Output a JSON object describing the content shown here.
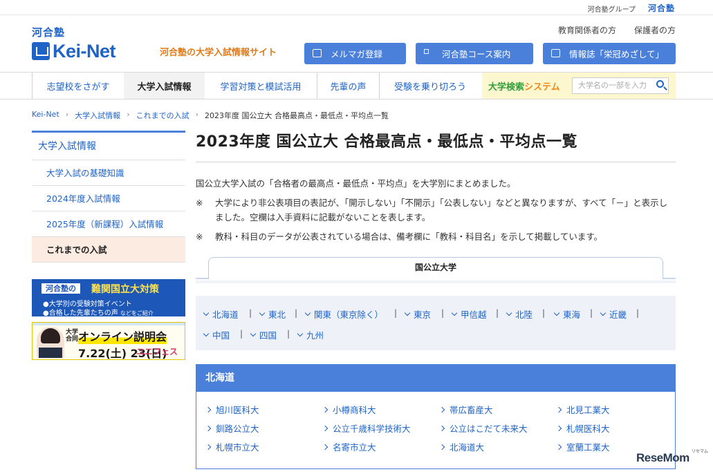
{
  "topbar": {
    "group_text": "河合塾グループ",
    "group_logo": "河合塾"
  },
  "header": {
    "logo_kanji": "河合塾",
    "logo_word": "Kei-Net",
    "tagline": "河合塾の大学入試情報サイト",
    "links": [
      "教育関係者の方",
      "保護者の方"
    ],
    "buttons": [
      {
        "label": "メルマガ登録",
        "icon": "mail-icon"
      },
      {
        "label": "河合塾コース案内",
        "icon": "grid-icon"
      },
      {
        "label": "情報誌「栄冠めざして」",
        "icon": "book-icon"
      }
    ]
  },
  "nav": {
    "items": [
      "志望校をさがす",
      "大学入試情報",
      "学習対策と模試活用",
      "先輩の声",
      "受験を乗り切ろう"
    ],
    "active_index": 1,
    "search_label_a": "大学検索",
    "search_label_b": "システム",
    "search_placeholder": "大学名の一部を入力"
  },
  "breadcrumb": {
    "items": [
      "Kei-Net",
      "大学入試情報",
      "これまでの入試",
      "2023年度 国公立大 合格最高点・最低点・平均点一覧"
    ],
    "separator": "›"
  },
  "sidebar": {
    "title": "大学入試情報",
    "items": [
      "大学入試の基礎知識",
      "2024年度入試情報",
      "2025年度（新課程）入試情報",
      "これまでの入試"
    ],
    "active_index": 3
  },
  "banner1": {
    "tag": "河合塾の",
    "headline": "難関国立大対策",
    "line1": "●大学別の受験対策イベント",
    "line2": "●合格した先輩たちの声",
    "line2_small": "などをご紹介"
  },
  "banner2": {
    "sub": "大学合同",
    "title": "オンライン説明会",
    "date": "7.22(土) 23(日)",
    "brand": "ユニフェス"
  },
  "main": {
    "title": "2023年度 国公立大 合格最高点・最低点・平均点一覧",
    "intro": "国公立大学入試の「合格者の最高点・最低点・平均点」を大学別にまとめました。",
    "notes": [
      {
        "mark": "※",
        "text": "大学により非公表項目の表記が、「開示しない」「不開示」「公表しない」などと異なりますが、すべて「－」と表示しました。空欄は入手資料に記載がないことを表します。"
      },
      {
        "mark": "※",
        "text": "教科・科目のデータが公表されている場合は、備考欄に「教科・科目名」を示して掲載しています。"
      }
    ],
    "tab_label": "国公立大学",
    "regions": [
      "北海道",
      "東北",
      "関東（東京除く）",
      "東京",
      "甲信越",
      "北陸",
      "東海",
      "近畿",
      "中国",
      "四国",
      "九州"
    ],
    "section_title": "北海道",
    "universities": [
      "旭川医科大",
      "小樽商科大",
      "帯広畜産大",
      "北見工業大",
      "釧路公立大",
      "公立千歳科学技術大",
      "公立はこだて未来大",
      "札幌医科大",
      "札幌市立大",
      "名寄市立大",
      "北海道大",
      "室蘭工業大"
    ]
  },
  "watermark": {
    "text": "ReseMom",
    "sub": "リセマム"
  },
  "colors": {
    "brand_blue": "#1f63c6",
    "button_blue": "#4a80d9",
    "tagline_orange": "#e07b19",
    "active_bg": "#fcebe1"
  }
}
